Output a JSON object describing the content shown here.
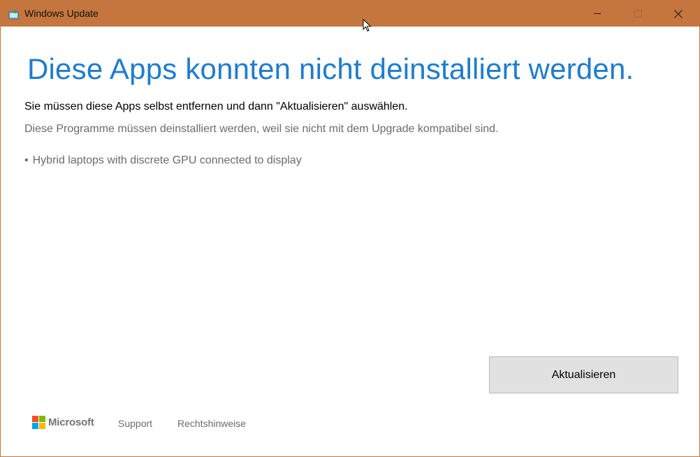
{
  "window": {
    "title": "Windows Update",
    "accent_color": "#c4763e",
    "icon": "windows-update-icon",
    "controls": {
      "minimize_icon": "minimize-icon",
      "maximize_icon": "maximize-icon",
      "close_icon": "close-icon",
      "close_glyph": "✕"
    }
  },
  "main": {
    "heading": "Diese Apps konnten nicht deinstalliert werden.",
    "heading_color": "#1f7ccd",
    "instruction": "Sie müssen diese Apps selbst entfernen und dann \"Aktualisieren\" auswählen.",
    "explanation": "Diese Programme müssen deinstalliert werden, weil sie nicht mit dem Upgrade kompatibel sind.",
    "apps": [
      {
        "bullet": "•",
        "name": "Hybrid laptops with discrete GPU connected to display"
      }
    ]
  },
  "actions": {
    "update_label": "Aktualisieren"
  },
  "footer": {
    "brand": "Microsoft",
    "logo_colors": [
      "#f25022",
      "#7fba00",
      "#00a4ef",
      "#ffb900"
    ],
    "support_label": "Support",
    "legal_label": "Rechtshinweise"
  }
}
